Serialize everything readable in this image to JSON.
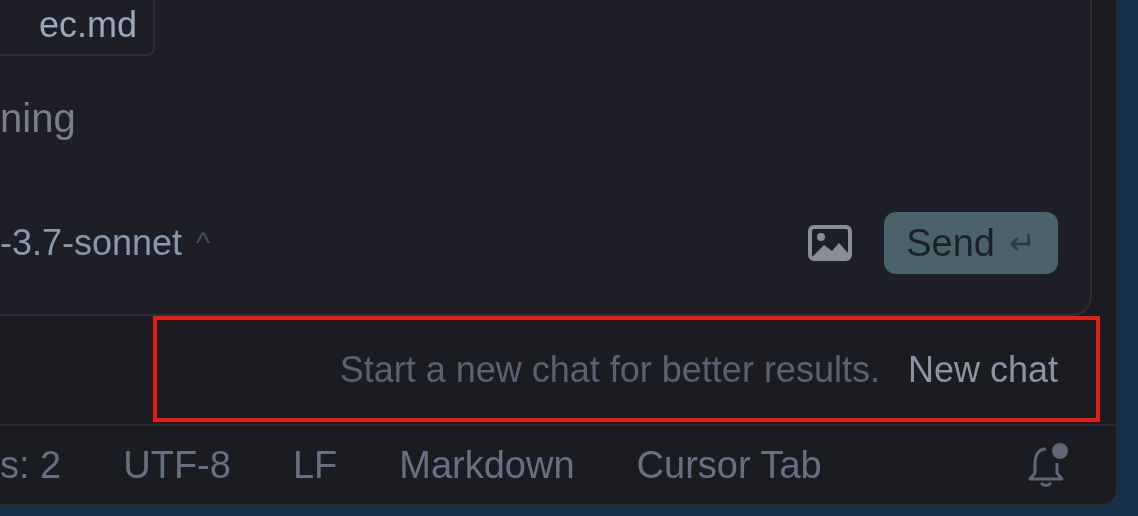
{
  "chat_panel": {
    "attached_file": "ec.md",
    "prompt": {
      "placeholder": "ning"
    },
    "model_selector": {
      "label": "-3.7-sonnet",
      "caret": "^",
      "expanded": false
    },
    "send_button": {
      "label": "Send",
      "shortcut": "↵"
    }
  },
  "new_chat_hint": {
    "text": "Start a new chat for better results.",
    "link": "New chat",
    "highlighted": true
  },
  "status_bar": {
    "items": [
      {
        "label": "s: 2"
      },
      {
        "label": "UTF-8"
      },
      {
        "label": "LF"
      },
      {
        "label": "Markdown"
      },
      {
        "label": "Cursor Tab"
      }
    ],
    "notification": {
      "unread": true
    }
  }
}
